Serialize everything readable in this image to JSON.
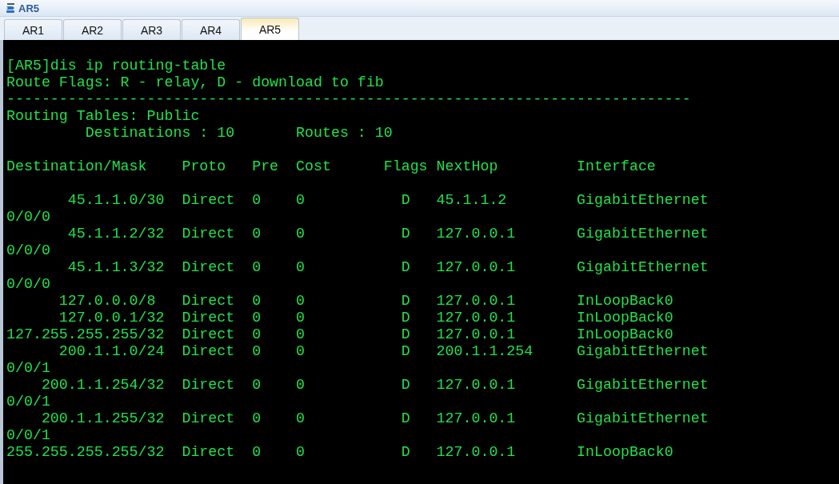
{
  "window": {
    "title": "AR5"
  },
  "tabs": [
    {
      "label": "AR1",
      "selected": false
    },
    {
      "label": "AR2",
      "selected": false
    },
    {
      "label": "AR3",
      "selected": false
    },
    {
      "label": "AR4",
      "selected": false
    },
    {
      "label": "AR5",
      "selected": true
    }
  ],
  "terminal": {
    "blocks": [
      {
        "lines": [
          "[AR5]dis ip routing-table",
          "Route Flags: R - relay, D - download to fib",
          "------------------------------------------------------------------------------",
          "Routing Tables: Public",
          "         Destinations : 10       Routes : 10"
        ]
      },
      {
        "lines": [
          "Destination/Mask    Proto   Pre  Cost      Flags NextHop         Interface"
        ]
      },
      {
        "lines": [
          "       45.1.1.0/30  Direct  0    0           D   45.1.1.2        GigabitEthernet",
          "0/0/0",
          "       45.1.1.2/32  Direct  0    0           D   127.0.0.1       GigabitEthernet",
          "0/0/0",
          "       45.1.1.3/32  Direct  0    0           D   127.0.0.1       GigabitEthernet",
          "0/0/0",
          "      127.0.0.0/8   Direct  0    0           D   127.0.0.1       InLoopBack0",
          "      127.0.0.1/32  Direct  0    0           D   127.0.0.1       InLoopBack0",
          "127.255.255.255/32  Direct  0    0           D   127.0.0.1       InLoopBack0",
          "      200.1.1.0/24  Direct  0    0           D   200.1.1.254     GigabitEthernet",
          "0/0/1",
          "    200.1.1.254/32  Direct  0    0           D   127.0.0.1       GigabitEthernet",
          "0/0/1",
          "    200.1.1.255/32  Direct  0    0           D   127.0.0.1       GigabitEthernet",
          "0/0/1",
          "255.255.255.255/32  Direct  0    0           D   127.0.0.1       InLoopBack0"
        ]
      }
    ]
  }
}
